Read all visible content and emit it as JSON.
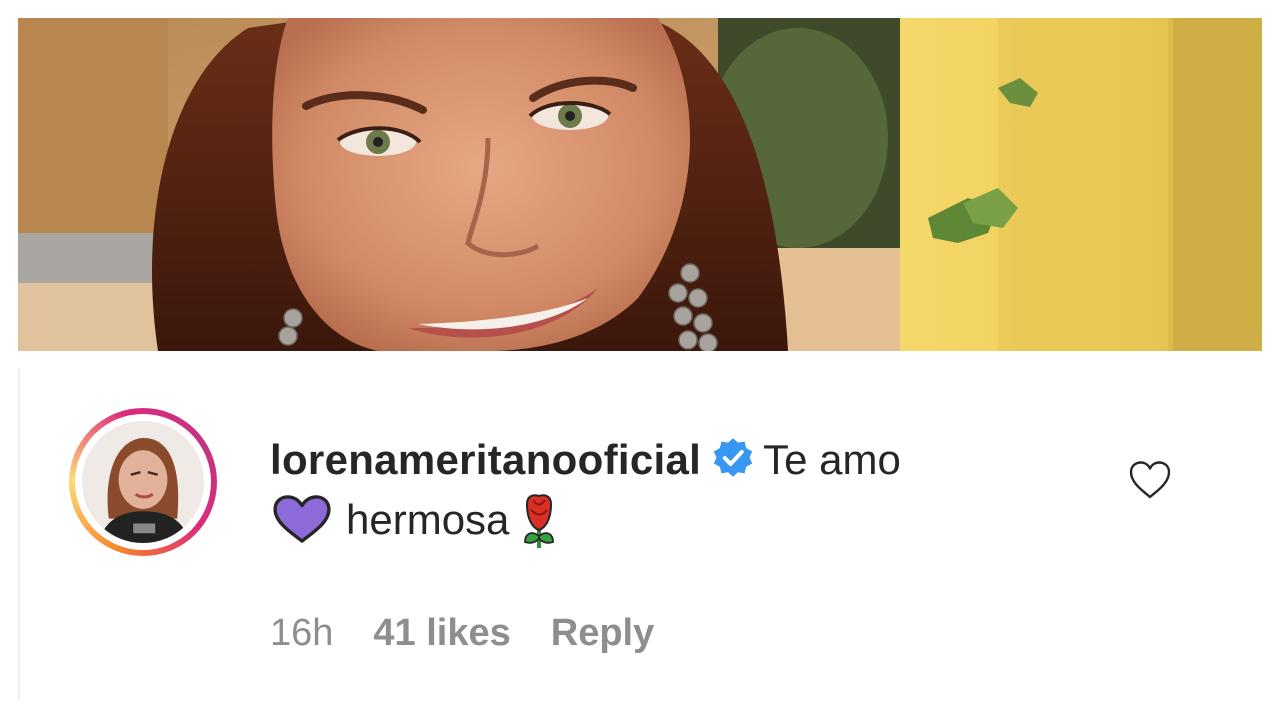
{
  "comment": {
    "username": "lorenameritanooficial",
    "text_part1": "Te amo",
    "text_part2": "hermosa",
    "emojis": [
      "purple-heart",
      "rose"
    ],
    "verified": true,
    "timestamp": "16h",
    "likes": "41 likes",
    "reply_label": "Reply"
  },
  "icons": {
    "verified": "verified-badge-icon",
    "like": "heart-outline-icon"
  },
  "colors": {
    "verified_blue": "#3897f0",
    "text_primary": "#262626",
    "text_secondary": "#8e8e8e",
    "purple_heart": "#8c6bd8",
    "rose_red": "#d93025"
  }
}
